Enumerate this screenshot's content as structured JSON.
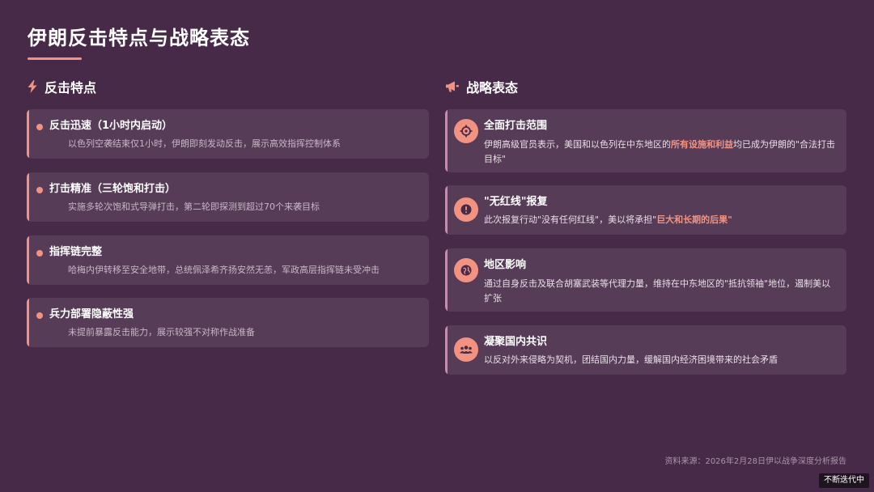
{
  "page": {
    "title": "伊朗反击特点与战略表态"
  },
  "colors": {
    "background": "#472A48",
    "accent": "#F29382",
    "right_border": "#C28FB0"
  },
  "left_section": {
    "icon": "bolt-icon",
    "heading": "反击特点",
    "cards": [
      {
        "title": "反击迅速（1小时内启动）",
        "desc": "以色列空袭结束仅1小时，伊朗即刻发动反击，展示高效指挥控制体系"
      },
      {
        "title": "打击精准（三轮饱和打击）",
        "desc": "实施多轮次饱和式导弹打击，第二轮即探测到超过70个来袭目标"
      },
      {
        "title": "指挥链完整",
        "desc": "哈梅内伊转移至安全地带，总统佩泽希齐扬安然无恙，军政高层指挥链未受冲击"
      },
      {
        "title": "兵力部署隐蔽性强",
        "desc": "未提前暴露反击能力，展示较强不对称作战准备"
      }
    ]
  },
  "right_section": {
    "icon": "megaphone-icon",
    "heading": "战略表态",
    "cards": [
      {
        "icon": "crosshair-icon",
        "title": "全面打击范围",
        "desc_pre": "伊朗高级官员表示，美国和以色列在中东地区的",
        "desc_hl": "所有设施和利益",
        "desc_post": "均已成为伊朗的\"合法打击目标\""
      },
      {
        "icon": "alert-icon",
        "title": "\"无红线\"报复",
        "desc_pre": "此次报复行动\"没有任何红线\"，美以将承担\"",
        "desc_hl": "巨大和长期的后果\"",
        "desc_post": ""
      },
      {
        "icon": "globe-icon",
        "title": "地区影响",
        "desc_pre": "通过自身反击及联合胡塞武装等代理力量，维持在中东地区的\"抵抗领袖\"地位，遏制美以扩张",
        "desc_hl": "",
        "desc_post": ""
      },
      {
        "icon": "people-icon",
        "title": "凝聚国内共识",
        "desc_pre": "以反对外来侵略为契机，团结国内力量，缓解国内经济困境带来的社会矛盾",
        "desc_hl": "",
        "desc_post": ""
      }
    ]
  },
  "footer": {
    "source": "资料来源：2026年2月28日伊以战争深度分析报告",
    "badge": "不断迭代中"
  }
}
